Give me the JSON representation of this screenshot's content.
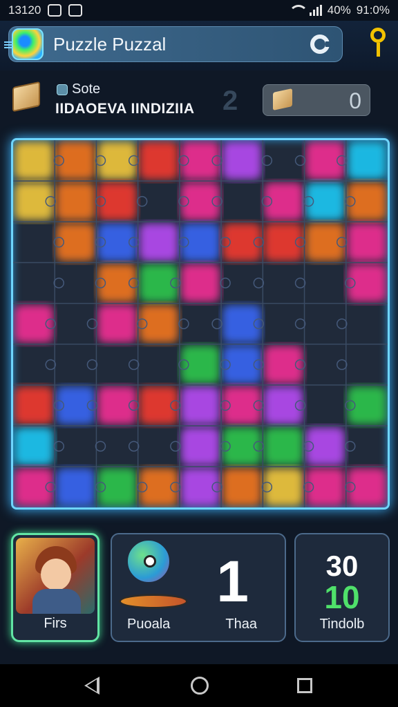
{
  "status_bar": {
    "time": "13120",
    "battery": "40%",
    "clock_right": "91:0%"
  },
  "header": {
    "title": "Puzzle Puzzal"
  },
  "info": {
    "label": "Sote",
    "subtitle": "IIDAOEVA IINDIZIIA",
    "level": "2",
    "pieces": "0"
  },
  "board": {
    "cols": 9,
    "rows": 9,
    "colors": [
      "#2fd04d",
      "#ff7a1a",
      "#3a6bff",
      "#ff2f9a",
      "#ffd23c",
      "#1ad1ff",
      "#c04dff",
      "#ff3a2f"
    ]
  },
  "bottom": {
    "character_label": "Firs",
    "mascot_label": "Puoala",
    "count": "1",
    "count_label": "Thaa",
    "timer_top": "30",
    "timer_bottom": "10",
    "timer_label": "Tindolb"
  },
  "colors": {
    "accent": "#6fd6ff",
    "timer_green": "#4fe06a"
  }
}
